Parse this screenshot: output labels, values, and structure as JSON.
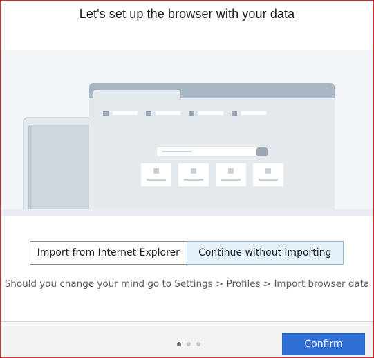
{
  "dialog": {
    "title": "Let's set up the browser with your data",
    "options": [
      {
        "label": "Import from Internet Explorer",
        "selected": false
      },
      {
        "label": "Continue without importing",
        "selected": true
      }
    ],
    "hint": "Should you change your mind go to  Settings > Profiles > Import browser data",
    "pagination": {
      "total": 3,
      "current": 1
    },
    "confirm_label": "Confirm"
  },
  "colors": {
    "accent": "#2f6fd6",
    "selected_option_bg": "#e5f1fb",
    "frame_border": "#e0282e"
  },
  "illustration": {
    "icon": "browser-windows-illustration"
  }
}
